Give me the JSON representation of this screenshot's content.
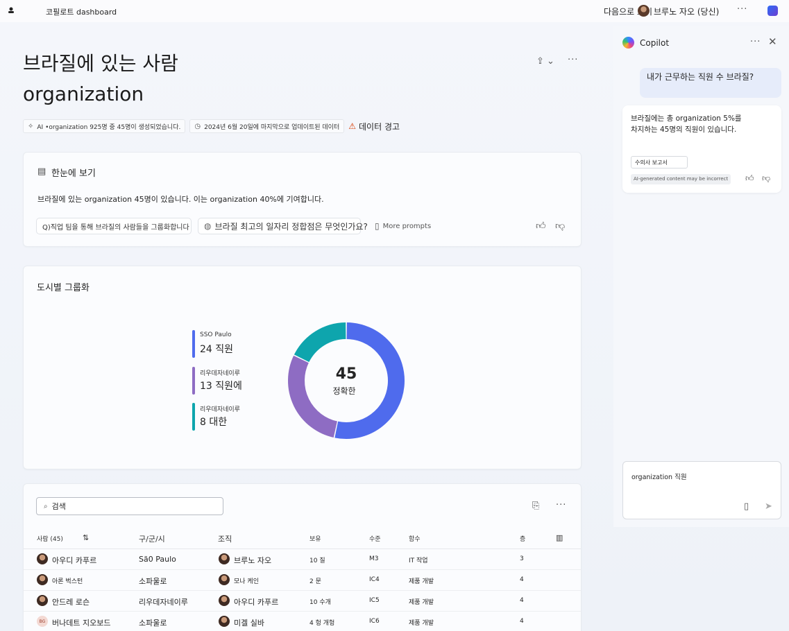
{
  "topbar": {
    "app_title": "코필로트 dashboard",
    "share_label": "다음으로 보기",
    "user_name": "브루노 자오 (당신)",
    "more": "···"
  },
  "header": {
    "title": "브라질에 있는 사람 organization",
    "more": "···"
  },
  "meta": {
    "ai_note": "AI •organization 925명 중 45명이 생성되었습니다.",
    "updated": "2024년 6월 20일에 마지막으로 업데이트된 데이터",
    "warning": "데이터 경고"
  },
  "glance": {
    "title": "한눈에 보기",
    "body": "브라질에 있는 organization 45명이 있습니다. 이는 organization 40%에 기여합니다.",
    "prompt1": "Q)직업 팀을 통해 브라질의 사람들을 그룹화합니다",
    "prompt2": "브라질 최고의 일자리 정합점은 무엇인가요?",
    "more_prompts": "More prompts"
  },
  "city": {
    "title": "도시별 그룹화",
    "legend": [
      {
        "name": "SSO Paulo",
        "value": "24 직원",
        "color": "#4f6bed"
      },
      {
        "name": "리우데자네이루",
        "value": "13 직원에",
        "color": "#8e6cc3"
      },
      {
        "name": "리우데자네이루",
        "value": "8 대한",
        "color": "#0ea5ad"
      }
    ],
    "total": "45",
    "total_label": "정확한"
  },
  "chart_data": {
    "type": "pie",
    "categories": [
      "SSO Paulo",
      "리우데자네이루",
      "리우데자네이루"
    ],
    "values": [
      24,
      13,
      8
    ],
    "title": "도시별 그룹화"
  },
  "table": {
    "search_placeholder": "검색",
    "headers": [
      "사람 (45)",
      "구/군/시",
      "조직",
      "보유",
      "수준",
      "함수",
      "층"
    ],
    "rows": [
      {
        "name": "아우디 카푸르",
        "city": "Sã0 Paulo",
        "org": "브루노 자오",
        "tenure": "10 질",
        "level": "M3",
        "func": "IT 작업",
        "floor": "3"
      },
      {
        "name": "아론 벅스턴",
        "city": "소파울로",
        "org": "모나 케인",
        "tenure": "2 문",
        "level": "IC4",
        "func": "제품 개발",
        "floor": "4"
      },
      {
        "name": "안드레 로슨",
        "city": "리우데자네이루",
        "org": "아우디 카푸르",
        "tenure": "10 수개",
        "level": "IC5",
        "func": "제품 개발",
        "floor": "4"
      },
      {
        "name": "버나데트 지오보드",
        "city": "소파울로",
        "org": "미겔 실바",
        "tenure": "4 헝 개헝",
        "level": "IC6",
        "func": "제품 개발",
        "floor": "4",
        "initials": "BG"
      }
    ]
  },
  "copilot": {
    "title": "Copilot",
    "user_message": "내가 근무하는 직원 수 브라질?",
    "bot_message": "브라질에는 총 organization 5%를 차지하는 45명의 직원이 있습니다.",
    "bot_chip": "수의사 보고서",
    "ai_note": "AI-generated content may be incorrect",
    "composer_text": "organization 직원"
  }
}
